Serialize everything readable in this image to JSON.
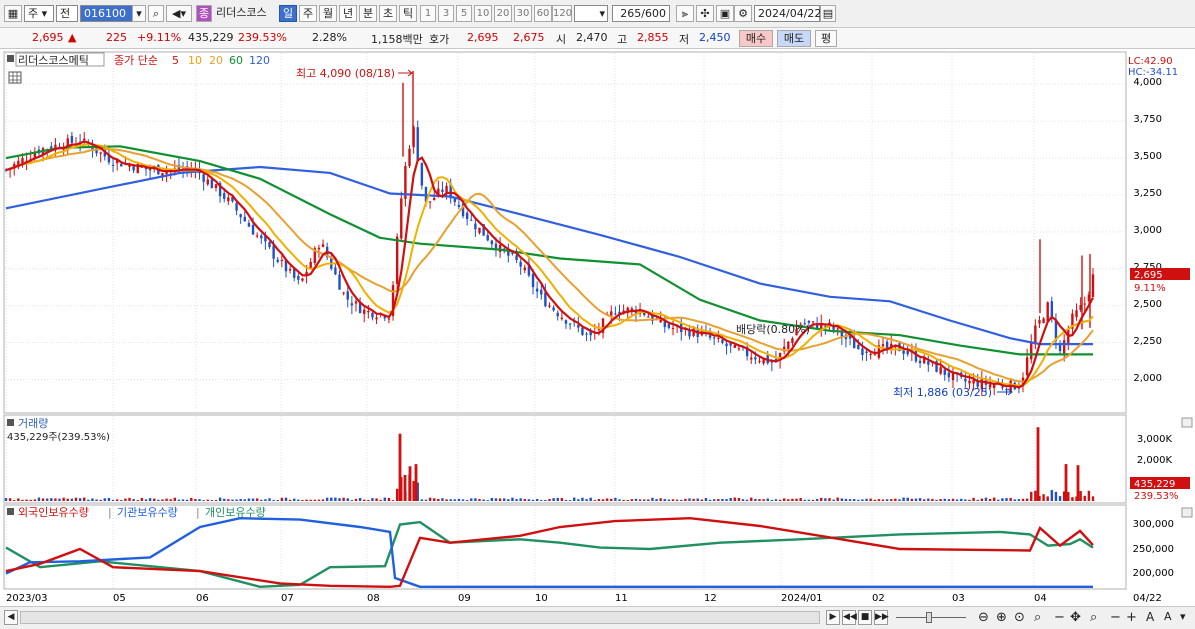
{
  "toolbar": {
    "market": "주",
    "type": "전",
    "code": "016100",
    "icon_badge": "종",
    "name": "리더스코스",
    "periods": [
      "일",
      "주",
      "월",
      "년",
      "분",
      "초",
      "틱"
    ],
    "active_period": "일",
    "intervals": [
      "1",
      "3",
      "5",
      "10",
      "20",
      "30",
      "60",
      "120"
    ],
    "count_current": "265",
    "count_total": "/600",
    "date": "2024/04/22"
  },
  "quote": {
    "price": "2,695",
    "change_arrow": "▲",
    "change": "225",
    "change_pct": "+9.11%",
    "volume": "435,229",
    "volume_ratio": "239.53%",
    "turnover": "2.28%",
    "amount": "1,158백만",
    "hoga_label": "호가",
    "ask": "2,695",
    "bid": "2,675",
    "open_label": "시",
    "open": "2,470",
    "high_label": "고",
    "high": "2,855",
    "low_label": "저",
    "low": "2,450",
    "buy_button": "매수",
    "sell_button": "매도",
    "avg_button": "평"
  },
  "price_panel": {
    "title": "리더스코스메틱",
    "ma_label": "종가 단순",
    "ma_periods": [
      "5",
      "10",
      "20",
      "60",
      "120"
    ],
    "ma_colors": [
      "#d01010",
      "#f0a000",
      "#e8a030",
      "#109030",
      "#3060e0"
    ],
    "y_ticks": [
      "4,000",
      "3,750",
      "3,500",
      "3,250",
      "3,000",
      "2,750",
      "2,500",
      "2,250",
      "2,000"
    ],
    "lc": "LC:42.90",
    "hc": "HC:-34.11",
    "price_tag": "2,695",
    "pct_tag": "9.11%",
    "high_annot": "최고 4,090 (08/18)",
    "low_annot": "최저 1,886 (03/25)",
    "dividend_annot": "배당락(0.80%)"
  },
  "volume_panel": {
    "title": "거래량",
    "value": "435,229주(239.53%)",
    "y_ticks": [
      "3,000K",
      "2,000K"
    ],
    "tag_value": "435,229",
    "tag_pct": "239.53%"
  },
  "holding_panel": {
    "legend": [
      "외국인보유수량",
      "기관보유수량",
      "개인보유수량"
    ],
    "legend_colors": [
      "#d01010",
      "#2060e0",
      "#209060"
    ],
    "y_ticks": [
      "300,000",
      "250,000",
      "200,000"
    ]
  },
  "x_axis": [
    "2023/03",
    "05",
    "06",
    "07",
    "08",
    "09",
    "10",
    "11",
    "12",
    "2024/01",
    "02",
    "03",
    "04"
  ],
  "x_axis_right": "04/22",
  "chart_data": {
    "type": "line",
    "title": "리더스코스메틱",
    "price_series_approx": {
      "name": "종가 단순 5",
      "x": [
        "2023/03",
        "2023/04",
        "2023/05",
        "2023/06",
        "2023/07",
        "2023/08",
        "2023/08/18",
        "2023/09",
        "2023/10",
        "2023/11",
        "2023/12",
        "2024/01",
        "2024/02",
        "2024/03",
        "2024/03/25",
        "2024/04",
        "2024/04/22"
      ],
      "values": [
        3400,
        3550,
        3450,
        3350,
        2700,
        2450,
        4090,
        3150,
        2550,
        2450,
        2350,
        2250,
        2150,
        1980,
        1886,
        2500,
        2695
      ]
    },
    "ma120_approx": {
      "name": "120",
      "x": [
        "2023/03",
        "2023/06",
        "2023/08",
        "2023/10",
        "2023/12",
        "2024/02",
        "2024/04"
      ],
      "values": [
        3150,
        3430,
        3250,
        3050,
        2700,
        2500,
        2250
      ]
    }
  }
}
